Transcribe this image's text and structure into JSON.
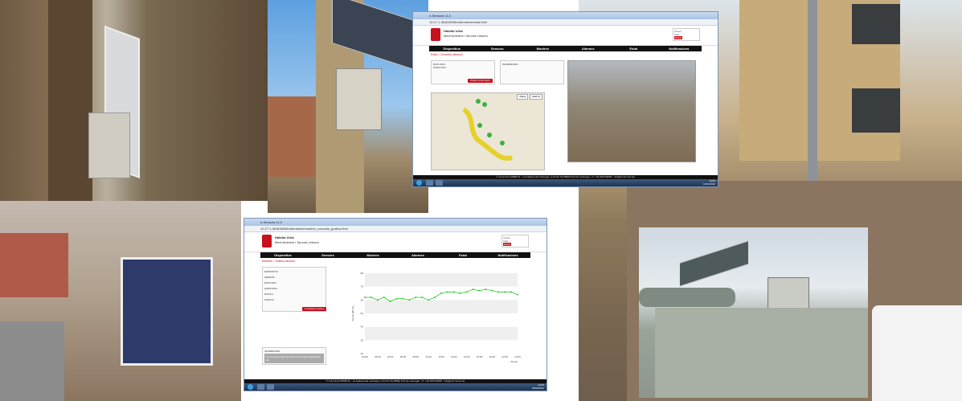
{
  "photos": [
    {
      "id": "p1",
      "subject": "solar-panel-on-wooden-pole"
    },
    {
      "id": "p2",
      "subject": "sensor-box-on-pole"
    },
    {
      "id": "p3",
      "subject": "solar-panel-on-wall"
    },
    {
      "id": "p4",
      "subject": "street-sensor-on-wall"
    },
    {
      "id": "p5",
      "subject": "sensor-on-industrial-unit"
    }
  ],
  "screen_top": {
    "tab_title": "e-Sensors v1.0",
    "url": "10.27.1.38:8080/MediAmbient/estat.html",
    "org_name": "Hàbitat Urbà",
    "org_sub": "Medi Ambient i Serveis Urbans",
    "login_user": "Usuari",
    "login_pass": "Clau",
    "login_button": "Entrar",
    "menu": [
      "Dispositius",
      "Sensors",
      "Mostres",
      "Alarmes",
      "Estat",
      "Notificacions"
    ],
    "breadcrumb": "Estat > Consulta ubicació",
    "form_label_1": "DATA INICI",
    "form_label_2": "HORA INICI",
    "form_button": "Obtenir informació",
    "info_title": "INCIDÈNCIES",
    "map_tab_1": "Mapa",
    "map_tab_2": "Satèl·lit",
    "footer": "© Communit SSMB SL - La Gaiteral del Llobregat, 2-10 Sur 5a 08820 Prat de Llobregat - Tf. +34 933749295 - info@communit.net",
    "clock_time": "16:50",
    "clock_date": "13/01/2012"
  },
  "screen_bottom": {
    "tab_title": "e-Sensors v1.0",
    "url": "10.27.1.38:8080/MediAmbient/mostres_consulta_grafica.html",
    "org_name": "Hàbitat Urbà",
    "org_sub": "Medi Ambient i Serveis Urbans",
    "login_user": "Usuari",
    "login_pass": "Clau",
    "login_button": "Entrar",
    "menu": [
      "Dispositius",
      "Sensors",
      "Mostres",
      "Alarmes",
      "Estat",
      "Notificacions"
    ],
    "breadcrumb": "Mostres > Gràfica sensors",
    "form_labels": [
      "DISPOSITIU",
      "SENSOR",
      "DATA INICI",
      "HORA INICI",
      "DATA FI",
      "HORA FI"
    ],
    "form_button": "Consultar mostres",
    "info_title": "INCIDÈNCIES",
    "info_text": "Lorem ipsum dolor sit amet, consectetur adipiscing elit",
    "footer": "© Communit SSMB SL - La Gaiteral del Llobregat, 2-10 Sur 5a 08820 Prat de Llobregat - Tf. +34 933749295 - info@communit.net",
    "clock_time": "10:46",
    "clock_date": "09/06/2012",
    "chart_ylabel": "Soroll (dB (A))",
    "chart_xlabel": "Temps"
  },
  "chart_data": {
    "type": "line",
    "x": [
      "00:00",
      "01:00",
      "02:00",
      "03:00",
      "04:00",
      "05:00",
      "06:00",
      "07:00",
      "08:00",
      "09:00",
      "10:00",
      "11:00",
      "12:00",
      "13:00",
      "14:00",
      "15:00",
      "16:00",
      "17:00",
      "18:00",
      "19:00",
      "20:00",
      "21:00",
      "22:00",
      "23:00",
      "24:00"
    ],
    "series": [
      {
        "values": [
          62,
          62,
          60,
          62,
          59,
          61,
          61,
          60,
          62,
          62,
          60,
          62,
          65,
          66,
          66,
          65,
          66,
          68,
          67,
          68,
          67,
          66,
          66,
          66,
          64
        ]
      }
    ],
    "ylim": [
      20,
      80
    ],
    "ylabel": "Soroll (dB (A))",
    "xlabel": "Temps",
    "color": "#2ecc2e"
  }
}
